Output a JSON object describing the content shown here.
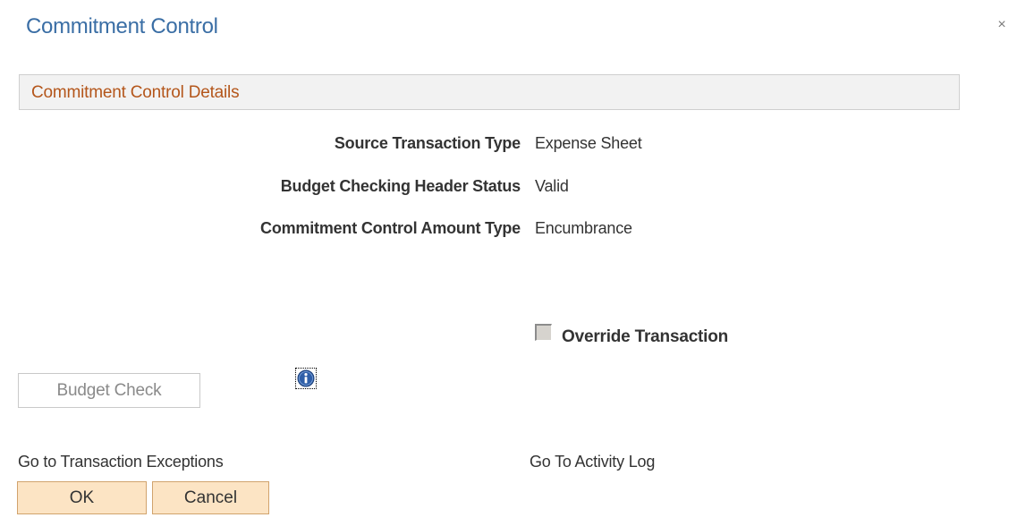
{
  "dialog": {
    "title": "Commitment Control",
    "close_glyph": "×"
  },
  "section": {
    "title": "Commitment Control Details"
  },
  "fields": [
    {
      "label": "Source Transaction Type",
      "value": "Expense Sheet"
    },
    {
      "label": "Budget Checking Header Status",
      "value": "Valid"
    },
    {
      "label": "Commitment Control Amount Type",
      "value": "Encumbrance"
    }
  ],
  "override": {
    "label": "Override Transaction",
    "checked": false
  },
  "budget_check": {
    "label": "Budget Check"
  },
  "links": {
    "exceptions": "Go to Transaction Exceptions",
    "activity_log": "Go To Activity Log"
  },
  "buttons": {
    "ok": "OK",
    "cancel": "Cancel"
  },
  "colors": {
    "title": "#3a6ea5",
    "section_title": "#b4561b",
    "button_fill": "#fce4c4",
    "info_icon": "#2f5fa8"
  },
  "icons": {
    "close": "close-icon",
    "info": "info-icon"
  }
}
